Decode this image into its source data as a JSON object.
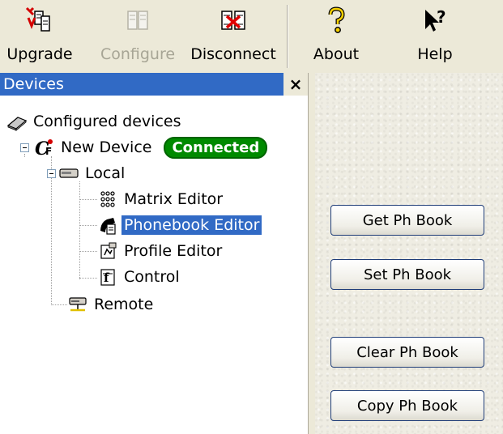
{
  "toolbar": {
    "upgrade_label": "Upgrade",
    "configure_label": "Configure",
    "disconnect_label": "Disconnect",
    "about_label": "About",
    "help_label": "Help"
  },
  "devices_panel": {
    "title": "Devices",
    "close_glyph": "×",
    "tree": {
      "root": "Configured devices",
      "device": "New Device",
      "status_badge": "Connected",
      "local": "Local",
      "matrix_editor": "Matrix Editor",
      "phonebook_editor": "Phonebook Editor",
      "profile_editor": "Profile Editor",
      "control": "Control",
      "remote": "Remote"
    },
    "selected_item": "Phonebook Editor"
  },
  "actions": {
    "get_label": "Get Ph Book",
    "set_label": "Set Ph Book",
    "clear_label": "Clear Ph Book",
    "copy_label": "Copy Ph Book"
  },
  "colors": {
    "selection": "#316ac5",
    "connected_badge": "#008a00",
    "toolbar_bg": "#ece9d8"
  }
}
